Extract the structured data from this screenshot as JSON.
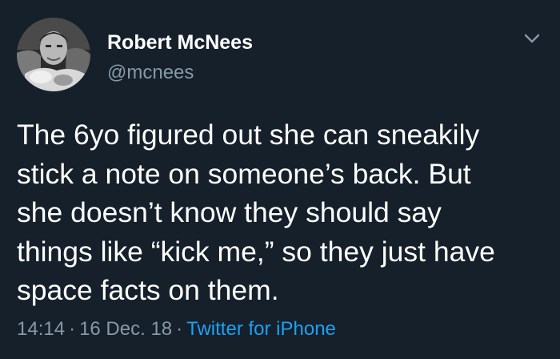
{
  "tweet": {
    "author": {
      "display_name": "Robert McNees",
      "handle": "@mcnees",
      "avatar_icon": "profile-photo"
    },
    "menu_icon": "chevron-down-icon",
    "text_lines": [
      "The 6yo figured out she can sneakily",
      "stick a note on someone’s back. But",
      "she doesn’t know they should say",
      "things like “kick me,” so they just have",
      "space facts on them."
    ],
    "time": "14:14",
    "date": "16 Dec. 18",
    "separator": "·",
    "source": "Twitter for iPhone"
  },
  "colors": {
    "background": "#15202b",
    "primary_text": "#ffffff",
    "secondary_text": "#8899a6",
    "link": "#1da1f2"
  }
}
